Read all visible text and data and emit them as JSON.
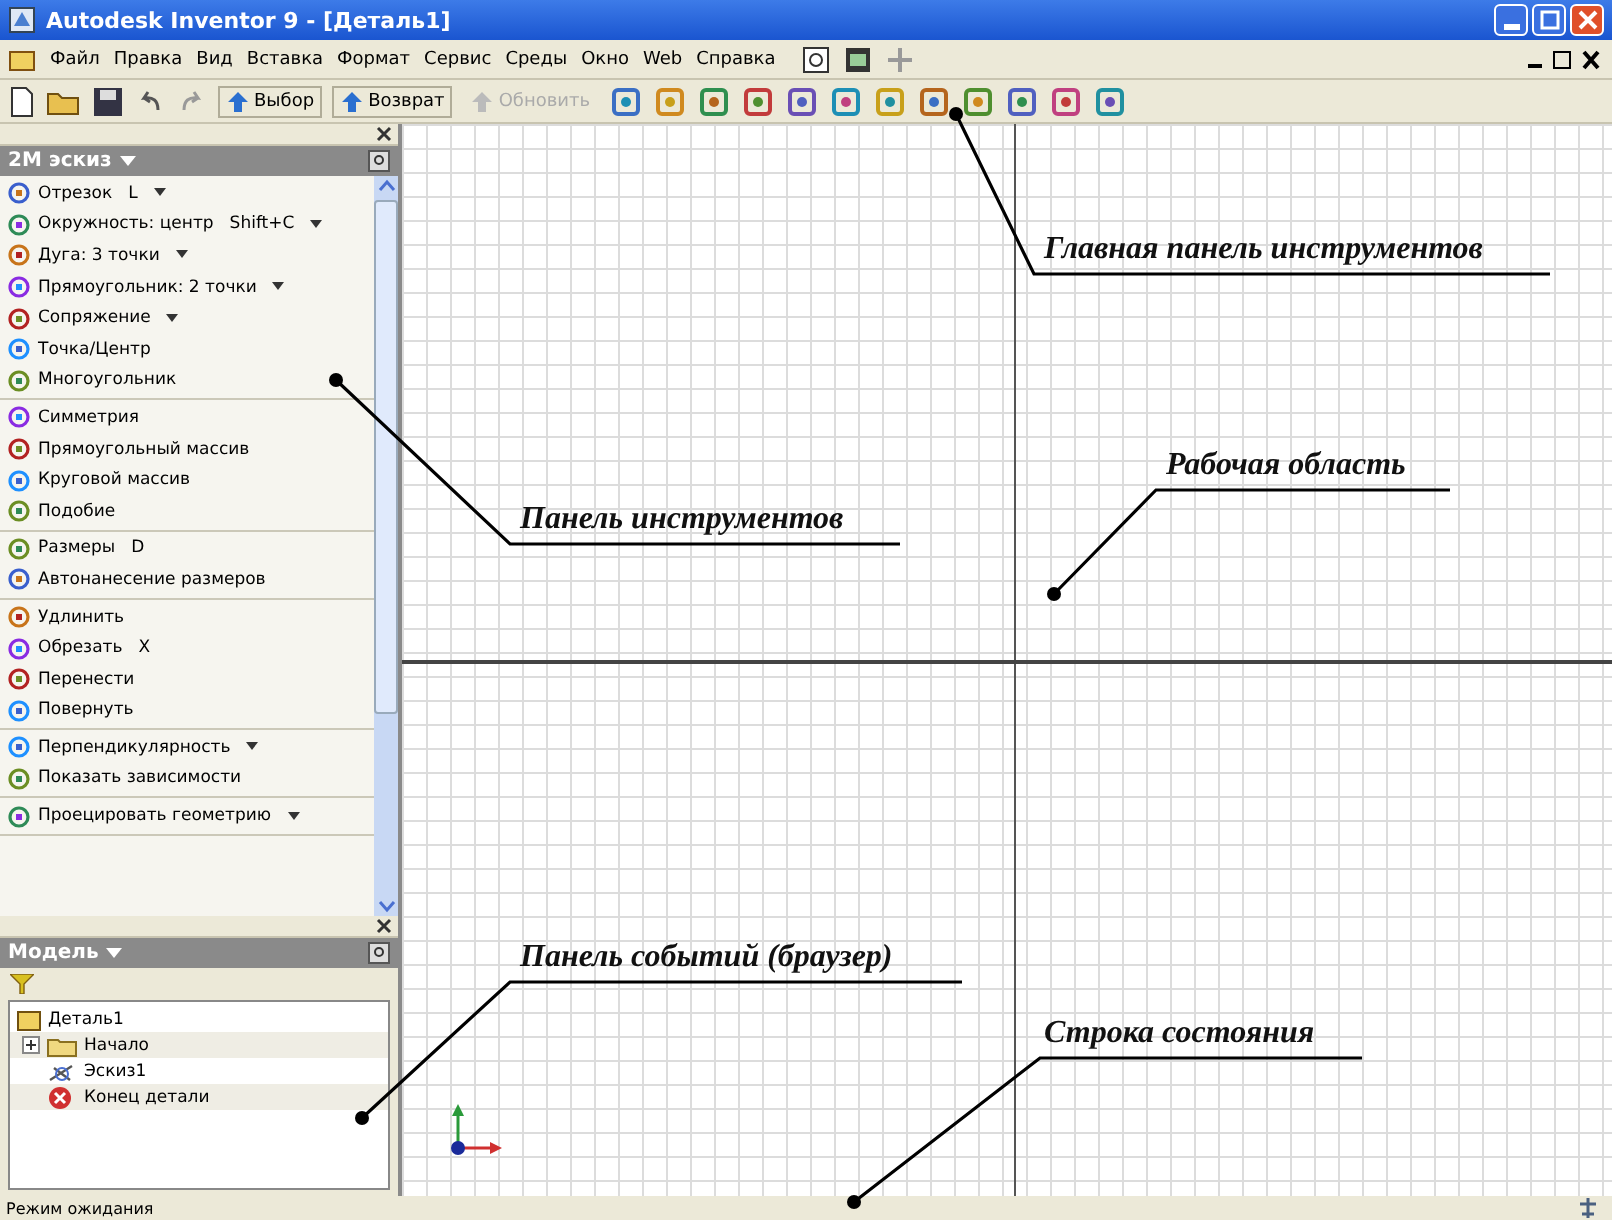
{
  "window": {
    "title": "Autodesk Inventor 9 - [Деталь1]"
  },
  "menu": [
    "Файл",
    "Правка",
    "Вид",
    "Вставка",
    "Формат",
    "Сервис",
    "Среды",
    "Окно",
    "Web",
    "Справка"
  ],
  "toolbar": [
    {
      "kind": "button",
      "label": "Выбор",
      "disabled": false
    },
    {
      "kind": "button",
      "label": "Возврат",
      "disabled": false
    },
    {
      "kind": "button",
      "label": "Обновить",
      "disabled": true
    }
  ],
  "sketch_panel": {
    "title": "2М эскиз",
    "groups": [
      [
        {
          "label": "Отрезок",
          "shortcut": "L",
          "dropdown": true
        },
        {
          "label": "Окружность: центр",
          "shortcut": "Shift+C",
          "dropdown": true
        },
        {
          "label": "Дуга: 3 точки",
          "dropdown": true
        },
        {
          "label": "Прямоугольник: 2 точки",
          "dropdown": true
        },
        {
          "label": "Сопряжение",
          "dropdown": true
        },
        {
          "label": "Точка/Центр",
          "dropdown": false
        },
        {
          "label": "Многоугольник",
          "dropdown": false
        }
      ],
      [
        {
          "label": "Симметрия",
          "dropdown": false
        },
        {
          "label": "Прямоугольный массив",
          "dropdown": false
        },
        {
          "label": "Круговой массив",
          "dropdown": false
        },
        {
          "label": "Подобие",
          "dropdown": false
        }
      ],
      [
        {
          "label": "Размеры",
          "shortcut": "D",
          "dropdown": false
        },
        {
          "label": "Автонанесение размеров",
          "dropdown": false
        }
      ],
      [
        {
          "label": "Удлинить",
          "dropdown": false
        },
        {
          "label": "Обрезать",
          "shortcut": "X",
          "dropdown": false
        },
        {
          "label": "Перенести",
          "dropdown": false
        },
        {
          "label": "Повернуть",
          "dropdown": false
        }
      ],
      [
        {
          "label": "Перпендикулярность",
          "dropdown": true
        },
        {
          "label": "Показать зависимости",
          "dropdown": false
        }
      ],
      [
        {
          "label": "Проецировать геометрию",
          "dropdown": true
        }
      ]
    ]
  },
  "browser": {
    "title": "Модель",
    "tree": [
      {
        "label": "Деталь1",
        "kind": "part",
        "children": [
          {
            "label": "Начало",
            "kind": "folder",
            "expanded": false
          },
          {
            "label": "Эскиз1",
            "kind": "sketch"
          },
          {
            "label": "Конец детали",
            "kind": "end"
          }
        ]
      }
    ]
  },
  "status_bar": {
    "text": "Режим ожидания"
  },
  "callouts": [
    "Главная панель инструментов",
    "Рабочая область",
    "Панель инструментов",
    "Панель событий (браузер)",
    "Строка состояния"
  ]
}
